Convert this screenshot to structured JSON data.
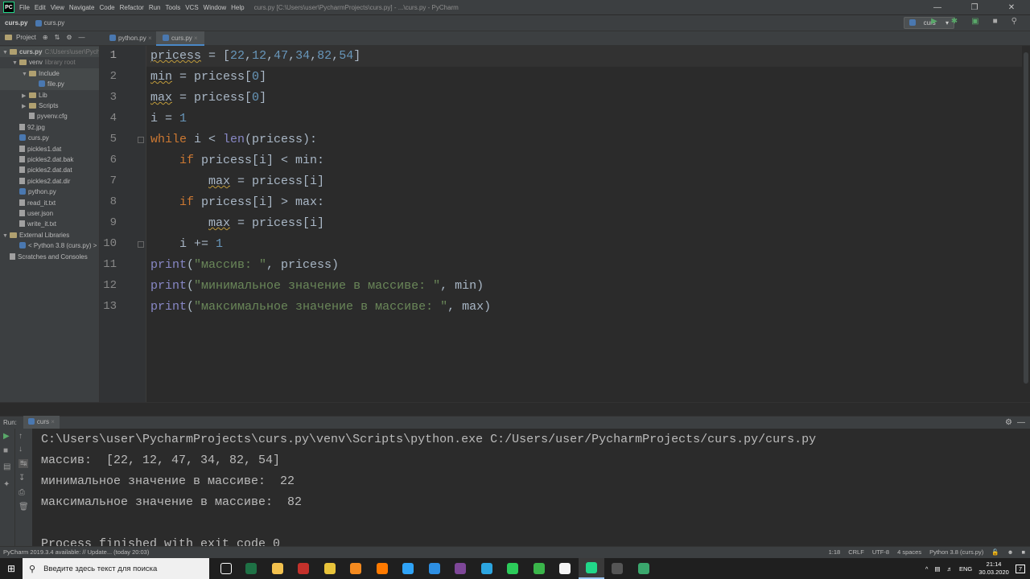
{
  "titlebar": {
    "menu": [
      "File",
      "Edit",
      "View",
      "Navigate",
      "Code",
      "Refactor",
      "Run",
      "Tools",
      "VCS",
      "Window",
      "Help"
    ],
    "window_title": "curs.py [C:\\Users\\user\\PycharmProjects\\curs.py] - ...\\curs.py - PyCharm"
  },
  "navbar": {
    "crumb1": "curs.py",
    "crumb2": "curs.py",
    "run_config": "curs"
  },
  "project_panel": {
    "label": "Project",
    "tree": [
      {
        "text": "curs.py",
        "hint": "C:\\Users\\user\\Pych",
        "type": "folder",
        "level": 0
      },
      {
        "text": "venv",
        "hint": "library root",
        "type": "folder",
        "level": 1
      },
      {
        "text": "Include",
        "hint": "",
        "type": "folder",
        "level": 2
      },
      {
        "text": "file.py",
        "hint": "",
        "type": "py",
        "level": 3
      },
      {
        "text": "Lib",
        "hint": "",
        "type": "folder",
        "level": 2
      },
      {
        "text": "Scripts",
        "hint": "",
        "type": "folder",
        "level": 2
      },
      {
        "text": "pyvenv.cfg",
        "hint": "",
        "type": "file",
        "level": 2
      },
      {
        "text": "92.jpg",
        "hint": "",
        "type": "file",
        "level": 1
      },
      {
        "text": "curs.py",
        "hint": "",
        "type": "py",
        "level": 1
      },
      {
        "text": "pickles1.dat",
        "hint": "",
        "type": "file",
        "level": 1
      },
      {
        "text": "pickles2.dat.bak",
        "hint": "",
        "type": "file",
        "level": 1
      },
      {
        "text": "pickles2.dat.dat",
        "hint": "",
        "type": "file",
        "level": 1
      },
      {
        "text": "pickles2.dat.dir",
        "hint": "",
        "type": "file",
        "level": 1
      },
      {
        "text": "python.py",
        "hint": "",
        "type": "py",
        "level": 1
      },
      {
        "text": "read_it.txt",
        "hint": "",
        "type": "file",
        "level": 1
      },
      {
        "text": "user.json",
        "hint": "",
        "type": "file",
        "level": 1
      },
      {
        "text": "write_it.txt",
        "hint": "",
        "type": "file",
        "level": 1
      },
      {
        "text": "External Libraries",
        "hint": "",
        "type": "folder",
        "level": 0
      },
      {
        "text": "< Python 3.8 (curs.py) >",
        "hint": "",
        "type": "py",
        "level": 1
      },
      {
        "text": "Scratches and Consoles",
        "hint": "",
        "type": "file",
        "level": 0
      }
    ]
  },
  "editor_tabs": [
    "python.py",
    "curs.py"
  ],
  "editor": {
    "line_numbers": [
      "1",
      "2",
      "3",
      "4",
      "5",
      "6",
      "7",
      "8",
      "9",
      "10",
      "11",
      "12",
      "13"
    ],
    "lines": [
      [
        {
          "t": "pricess",
          "c": "wv"
        },
        {
          "t": " = ["
        },
        {
          "t": "22",
          "c": "num"
        },
        {
          "t": ","
        },
        {
          "t": "12",
          "c": "num"
        },
        {
          "t": ","
        },
        {
          "t": "47",
          "c": "num"
        },
        {
          "t": ","
        },
        {
          "t": "34",
          "c": "num"
        },
        {
          "t": ","
        },
        {
          "t": "82",
          "c": "num"
        },
        {
          "t": ","
        },
        {
          "t": "54",
          "c": "num"
        },
        {
          "t": "]"
        }
      ],
      [
        {
          "t": "min",
          "c": "wv"
        },
        {
          "t": " = pricess["
        },
        {
          "t": "0",
          "c": "num"
        },
        {
          "t": "]"
        }
      ],
      [
        {
          "t": "max",
          "c": "wv"
        },
        {
          "t": " = pricess["
        },
        {
          "t": "0",
          "c": "num"
        },
        {
          "t": "]"
        }
      ],
      [
        {
          "t": "i = "
        },
        {
          "t": "1",
          "c": "num"
        }
      ],
      [
        {
          "t": "while",
          "c": "kw"
        },
        {
          "t": " i < "
        },
        {
          "t": "len",
          "c": "fn"
        },
        {
          "t": "(pricess):"
        }
      ],
      [
        {
          "t": "    "
        },
        {
          "t": "if",
          "c": "kw"
        },
        {
          "t": " pricess[i] < min:"
        }
      ],
      [
        {
          "t": "        "
        },
        {
          "t": "max",
          "c": "wv"
        },
        {
          "t": " = pricess[i]"
        }
      ],
      [
        {
          "t": "    "
        },
        {
          "t": "if",
          "c": "kw"
        },
        {
          "t": " pricess[i] > max:"
        }
      ],
      [
        {
          "t": "        "
        },
        {
          "t": "max",
          "c": "wv"
        },
        {
          "t": " = pricess[i]"
        }
      ],
      [
        {
          "t": "    i += "
        },
        {
          "t": "1",
          "c": "num"
        }
      ],
      [
        {
          "t": "print",
          "c": "fn"
        },
        {
          "t": "("
        },
        {
          "t": "\"массив: \"",
          "c": "str"
        },
        {
          "t": ", pricess)"
        }
      ],
      [
        {
          "t": "print",
          "c": "fn"
        },
        {
          "t": "("
        },
        {
          "t": "\"минимальное значение в массиве: \"",
          "c": "str"
        },
        {
          "t": ", min)"
        }
      ],
      [
        {
          "t": "print",
          "c": "fn"
        },
        {
          "t": "("
        },
        {
          "t": "\"максимальное значение в массиве: \"",
          "c": "str"
        },
        {
          "t": ", max)"
        }
      ]
    ]
  },
  "run_panel": {
    "label": "Run:",
    "tab": "curs",
    "output": [
      "C:\\Users\\user\\PycharmProjects\\curs.py\\venv\\Scripts\\python.exe C:/Users/user/PycharmProjects/curs.py/curs.py",
      "массив:  [22, 12, 47, 34, 82, 54]",
      "минимальное значение в массиве:  22",
      "максимальное значение в массиве:  82",
      "",
      "Process finished with exit code 0"
    ]
  },
  "statusbar": {
    "message": "PyCharm 2019.3.4 available: // Update... (today 20:03)",
    "position": "1:18",
    "line_sep": "CRLF",
    "encoding": "UTF-8",
    "indent": "4 spaces",
    "interpreter": "Python 3.8 (curs.py)"
  },
  "taskbar": {
    "search_placeholder": "Введите здесь текст для поиска",
    "lang": "ENG",
    "time": "21:14",
    "date": "30.03.2020",
    "notifications": "7",
    "apps": [
      {
        "name": "task-view",
        "color": "#1f1f1f"
      },
      {
        "name": "excel",
        "color": "#1e7145"
      },
      {
        "name": "file-explorer",
        "color": "#f2c14e"
      },
      {
        "name": "acrobat",
        "color": "#c4312b"
      },
      {
        "name": "chrome",
        "color": "#e8c33a"
      },
      {
        "name": "sublime",
        "color": "#f48a1f"
      },
      {
        "name": "sourcetree",
        "color": "#ff7a00"
      },
      {
        "name": "photoshop",
        "color": "#2fa3f7"
      },
      {
        "name": "vscode",
        "color": "#2d8fe3"
      },
      {
        "name": "tor",
        "color": "#7e4798"
      },
      {
        "name": "telegram",
        "color": "#2ca5e0"
      },
      {
        "name": "whatsapp",
        "color": "#2ccb5a"
      },
      {
        "name": "vpn",
        "color": "#3ab54a"
      },
      {
        "name": "notepad",
        "color": "#f4f4f4"
      },
      {
        "name": "pycharm",
        "color": "#21d789"
      },
      {
        "name": "terminal",
        "color": "#555555"
      },
      {
        "name": "app-c",
        "color": "#3aa76d"
      }
    ]
  }
}
